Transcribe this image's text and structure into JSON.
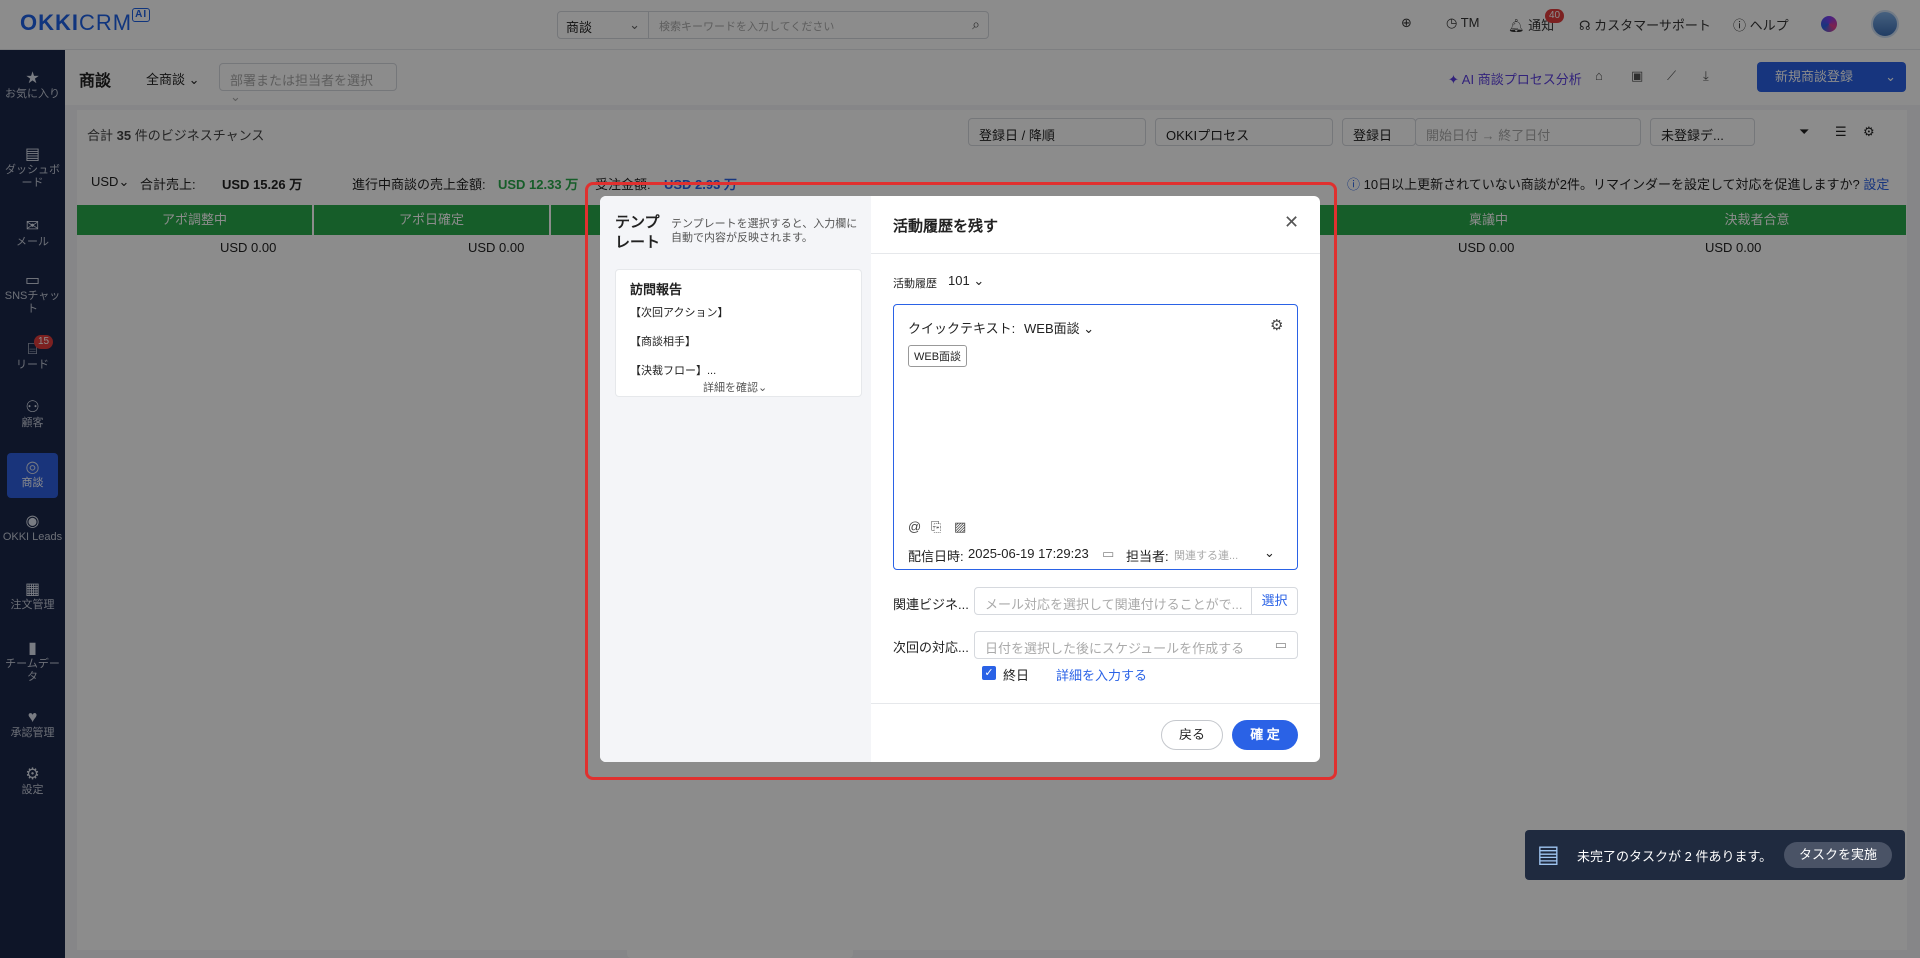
{
  "app": {
    "logo": "OKKI",
    "logo_crm": "CRM",
    "logo_ai": "AI"
  },
  "topbar": {
    "search_type": "商談",
    "search_placeholder": "検索キーワードを入力してください",
    "tm": "TM",
    "notify": "通知",
    "notify_count": "40",
    "support": "カスタマーサポート",
    "help": "ヘルプ"
  },
  "sidebar": {
    "items": [
      {
        "label": "お気に入り",
        "icon": "star-icon"
      },
      {
        "label": "ダッシュボード",
        "icon": "dashboard-icon"
      },
      {
        "label": "メール",
        "icon": "mail-icon"
      },
      {
        "label": "SNSチャット",
        "icon": "chat-icon"
      },
      {
        "label": "リード",
        "icon": "lead-icon",
        "badge": "15"
      },
      {
        "label": "顧客",
        "icon": "customer-icon"
      },
      {
        "label": "商談",
        "icon": "target-icon"
      },
      {
        "label": "OKKI Leads",
        "icon": "leads-icon"
      },
      {
        "label": "注文管理",
        "icon": "order-icon"
      },
      {
        "label": "チームデータ",
        "icon": "chart-icon"
      },
      {
        "label": "承認管理",
        "icon": "approval-icon"
      },
      {
        "label": "設定",
        "icon": "settings-icon"
      }
    ]
  },
  "page": {
    "title": "商談",
    "scope": "全商談",
    "dept_placeholder": "部署または担当者を選択",
    "ai_link": "AI 商談プロセス分析",
    "new_button": "新規商談登録",
    "total_prefix": "合計",
    "total_count": "35",
    "total_suffix": "件のビジネスチャンス",
    "sort": "登録日 / 降順",
    "process": "OKKIプロセス",
    "date_field": "登録日",
    "start_date": "開始日付",
    "end_date": "終了日付",
    "unregistered": "未登録デ...",
    "currency": "USD",
    "sales_label": "合計売上:",
    "sales_value": "USD 15.26 万",
    "ongoing_label": "進行中商談の売上金額:",
    "ongoing_value": "USD 12.33 万",
    "won_label": "受注金額:",
    "won_value": "USD 2.93 万",
    "reminder": "10日以上更新されていない商談が2件。リマインダーを設定して対応を促進しますか?",
    "reminder_link": "設定"
  },
  "stages": [
    {
      "name": "アポ調整中",
      "amount": "USD 0.00"
    },
    {
      "name": "アポ日確定",
      "amount": "USD 0.00"
    },
    {
      "name": "稟議中",
      "amount": "USD 0.00"
    },
    {
      "name": "決裁者合意",
      "amount": "USD 0.00"
    }
  ],
  "modal": {
    "template_title": "テンプレート",
    "template_hint": "テンプレートを選択すると、入力欄に自動で内容が反映されます。",
    "template_card_title": "訪問報告",
    "template_lines": [
      "【次回アクション】",
      "【商談相手】",
      "【決裁フロー】..."
    ],
    "template_more": "詳細を確認",
    "title": "活動履歴を残す",
    "activity_label": "活動履歴",
    "activity_value": "101",
    "quick_text_label": "クイックテキスト:",
    "quick_text_value": "WEB面談",
    "tag": "WEB面談",
    "send_date_label": "配信日時:",
    "send_date_value": "2025-06-19 17:29:23",
    "owner_label": "担当者:",
    "owner_placeholder": "関連する連...",
    "related_label": "関連ビジネ...",
    "related_placeholder": "メール対応を選択して関連付けることがで...",
    "select_btn": "選択",
    "next_label": "次回の対応...",
    "next_placeholder": "日付を選択した後にスケジュールを作成する",
    "allday": "終日",
    "detail_link": "詳細を入力する",
    "back": "戻る",
    "confirm": "確 定"
  },
  "task_toast": {
    "text": "未完了のタスクが 2 件あります。",
    "button": "タスクを実施"
  },
  "colors": {
    "primary": "#2a62e6",
    "stage_green": "#29a94b",
    "sidebar": "#1b2749",
    "highlight_frame": "#e0302f"
  }
}
